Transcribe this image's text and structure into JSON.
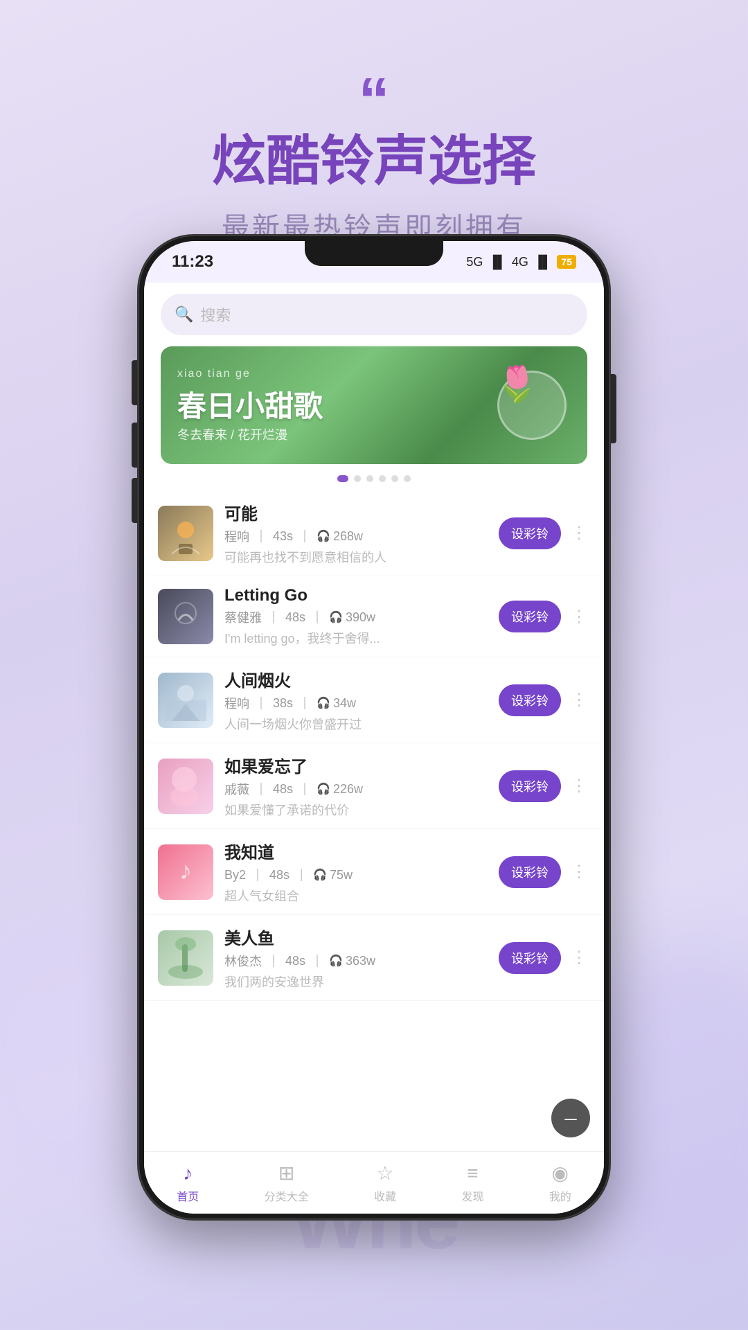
{
  "background": {
    "color": "#ddd5f0"
  },
  "header": {
    "quote_mark": "“",
    "title": "炫酷铃声选择",
    "subtitle": "最新最热铃声即刻拥有"
  },
  "status_bar": {
    "time": "11:23",
    "signal1": "5G",
    "signal2": "4G",
    "battery": "75"
  },
  "search": {
    "placeholder": "搜索",
    "icon": "🔍"
  },
  "banner": {
    "title_en": "xiao tian ge",
    "title_cn": "春日小甜歌",
    "subtitle": "冬去春来 / 花开烂漫",
    "dots": [
      true,
      false,
      false,
      false,
      false,
      false
    ]
  },
  "songs": [
    {
      "id": 1,
      "title": "可能",
      "artist": "程响",
      "duration": "43s",
      "plays": "268w",
      "desc": "可能再也找不到愿意相信的人",
      "cover_class": "cover-1"
    },
    {
      "id": 2,
      "title": "Letting Go",
      "artist": "蔡健雅",
      "duration": "48s",
      "plays": "390w",
      "desc": "I'm letting go，我终于舍得...",
      "cover_class": "cover-2"
    },
    {
      "id": 3,
      "title": "人间烟火",
      "artist": "程响",
      "duration": "38s",
      "plays": "34w",
      "desc": "人间一场烟火你曾盛开过",
      "cover_class": "cover-3"
    },
    {
      "id": 4,
      "title": "如果爱忘了",
      "artist": "戚薇",
      "duration": "48s",
      "plays": "226w",
      "desc": "如果爱懂了承诺的代价",
      "cover_class": "cover-4"
    },
    {
      "id": 5,
      "title": "我知道",
      "artist": "By2",
      "duration": "48s",
      "plays": "75w",
      "desc": "超人气女组合",
      "cover_class": "cover-5"
    },
    {
      "id": 6,
      "title": "美人鱼",
      "artist": "林俊杰",
      "duration": "48s",
      "plays": "363w",
      "desc": "我们两的安逸世界",
      "cover_class": "cover-6"
    }
  ],
  "set_btn_label": "设彩铃",
  "bottom_nav": [
    {
      "id": "home",
      "label": "首页",
      "icon": "♪",
      "active": true
    },
    {
      "id": "category",
      "label": "分类大全",
      "icon": "⊞",
      "active": false
    },
    {
      "id": "favorites",
      "label": "收藏",
      "icon": "☆",
      "active": false
    },
    {
      "id": "discover",
      "label": "发现",
      "icon": "≡",
      "active": false
    },
    {
      "id": "profile",
      "label": "我的",
      "icon": "👤",
      "active": false
    }
  ],
  "watermark": "Whe"
}
